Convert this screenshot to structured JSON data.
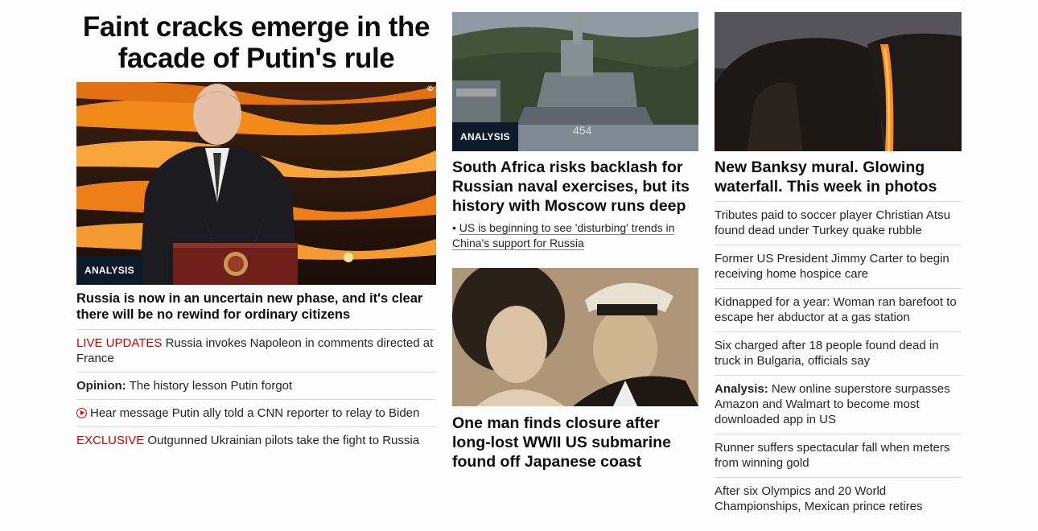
{
  "lead": {
    "headline": "Faint cracks emerge in the facade of Putin's rule",
    "badge": "ANALYSIS",
    "title": "Russia is now in an uncertain new phase, and it's clear there will be no rewind for ordinary citizens",
    "links": [
      {
        "tag": "LIVE UPDATES",
        "text": "Russia invokes Napoleon in comments directed at France"
      },
      {
        "label": "Opinion:",
        "text": "The history lesson Putin forgot"
      },
      {
        "icon": "play-icon",
        "text": "Hear message Putin ally told a CNN reporter to relay to Biden"
      },
      {
        "tag": "EXCLUSIVE",
        "text": "Outgunned Ukrainian pilots take the fight to Russia"
      }
    ]
  },
  "middle": {
    "story1": {
      "badge": "ANALYSIS",
      "title": "South Africa risks backlash for Russian naval exercises, but its history with Moscow runs deep",
      "bullet": "US is beginning to see 'disturbing' trends in China's support for Russia"
    },
    "story2": {
      "title": "One man finds closure after long-lost WWII US submarine found off Japanese coast"
    }
  },
  "right": {
    "title": "New Banksy mural. Glowing waterfall. This week in photos",
    "links": [
      {
        "text": "Tributes paid to soccer player Christian Atsu found dead under Turkey quake rubble"
      },
      {
        "text": "Former US President Jimmy Carter to begin receiving home hospice care"
      },
      {
        "text": "Kidnapped for a year: Woman ran barefoot to escape her abductor at a gas station"
      },
      {
        "text": "Six charged after 18 people found dead in truck in Bulgaria, officials say"
      },
      {
        "label": "Analysis:",
        "text": "New online superstore surpasses Amazon and Walmart to become most downloaded app in US"
      },
      {
        "text": "Runner suffers spectacular fall when meters from winning gold"
      },
      {
        "text": "After six Olympics and 20 World Championships, Mexican prince retires"
      }
    ]
  },
  "colors": {
    "accent_red": "#cc0000",
    "badge_bg": "#0c1a2a"
  }
}
